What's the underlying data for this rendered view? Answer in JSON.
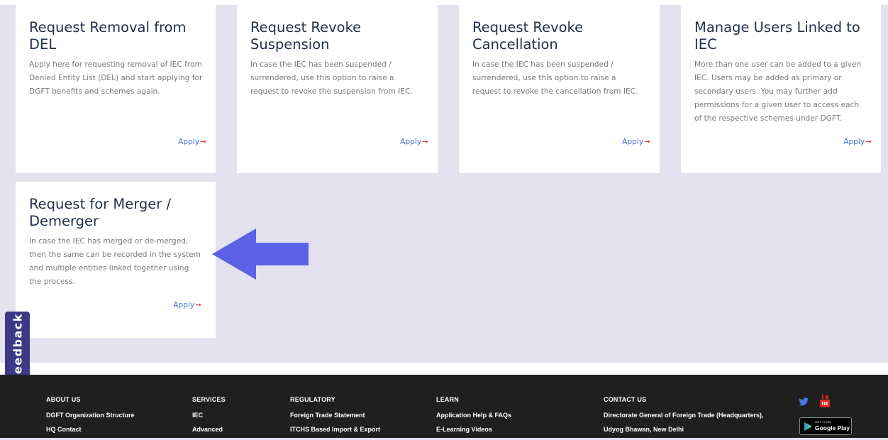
{
  "cards": [
    {
      "title": "Request Removal from DEL",
      "description": "Apply here for requesting removal of IEC from Denied Entity List (DEL) and start applying for DGFT benefits and schemes again.",
      "apply_label": "Apply"
    },
    {
      "title": "Request Revoke Suspension",
      "description": "In case the IEC has been suspended / surrendered, use this option to raise a request to revoke the suspension from IEC.",
      "apply_label": "Apply"
    },
    {
      "title": "Request Revoke Cancellation",
      "description": "In case the IEC has been suspended / surrendered, use this option to raise a request to revoke the cancellation from IEC.",
      "apply_label": "Apply"
    },
    {
      "title": "Manage Users Linked to IEC",
      "description": "More than one user can be added to a given IEC. Users may be added as primary or secondary users. You may further add permissions for a given user to access each of the respective schemes under DGFT.",
      "apply_label": "Apply"
    },
    {
      "title": "Request for Merger / Demerger",
      "description": "In case the IEC has merged or de-merged, then the same can be recorded in the system and multiple entities linked together using the process.",
      "apply_label": "Apply"
    }
  ],
  "apply_arrow": "➞",
  "feedback_label": "Feedback",
  "colors": {
    "background": "#e3e2ee",
    "card_title": "#1f2f49",
    "apply_link": "#3d6fd1",
    "apply_arrow": "#e23b2e",
    "annotation_arrow": "#5b62e8",
    "feedback_tab": "#3e3985",
    "footer_bg": "#1f1f1f"
  },
  "footer": {
    "about": {
      "heading": "ABOUT US",
      "links": [
        "DGFT Organization Structure",
        "HQ Contact"
      ]
    },
    "services": {
      "heading": "SERVICES",
      "links": [
        "IEC",
        "Advanced"
      ]
    },
    "regulatory": {
      "heading": "REGULATORY",
      "links": [
        "Foreign Trade Statement",
        "ITCHS Based Import & Export"
      ]
    },
    "learn": {
      "heading": "LEARN",
      "links": [
        "Application Help & FAQs",
        "E-Learning Videos"
      ]
    },
    "contact": {
      "heading": "CONTACT US",
      "lines": [
        "Directorate General of Foreign Trade (Headquarters),",
        "Udyog Bhawan, New Delhi"
      ]
    },
    "social_icons": [
      "twitter-icon",
      "youtube-icon"
    ],
    "google_play": {
      "small": "GET IT ON",
      "big": "Google Play"
    }
  }
}
